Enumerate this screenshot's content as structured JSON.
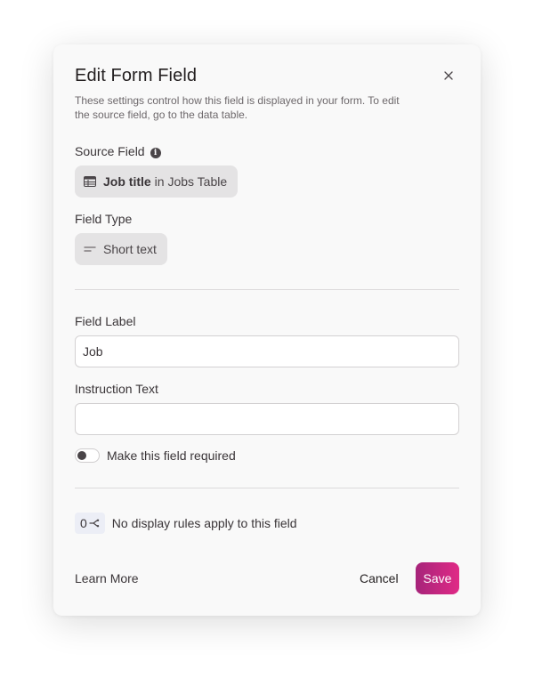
{
  "dialog": {
    "title": "Edit Form Field",
    "description": "These settings control how this field is displayed in your form. To edit the source field, go to the data table."
  },
  "source_field": {
    "label": "Source Field",
    "info_icon": "info-icon",
    "field_name": "Job title",
    "table_text": "in Jobs Table",
    "icon": "table-icon"
  },
  "field_type": {
    "label": "Field Type",
    "value": "Short text",
    "icon": "short-text-icon"
  },
  "field_label": {
    "label": "Field Label",
    "value": "Job"
  },
  "instruction_text": {
    "label": "Instruction Text",
    "value": ""
  },
  "required": {
    "label": "Make this field required",
    "checked": false
  },
  "display_rules": {
    "count": "0",
    "icon": "branch-icon",
    "text": "No display rules apply to this field"
  },
  "footer": {
    "learn_more": "Learn More",
    "cancel": "Cancel",
    "save": "Save"
  },
  "colors": {
    "save_gradient_start": "#a6247a",
    "save_gradient_end": "#e02a86",
    "chip_background": "#e4e3e4",
    "rules_badge_background": "#eceef6"
  }
}
